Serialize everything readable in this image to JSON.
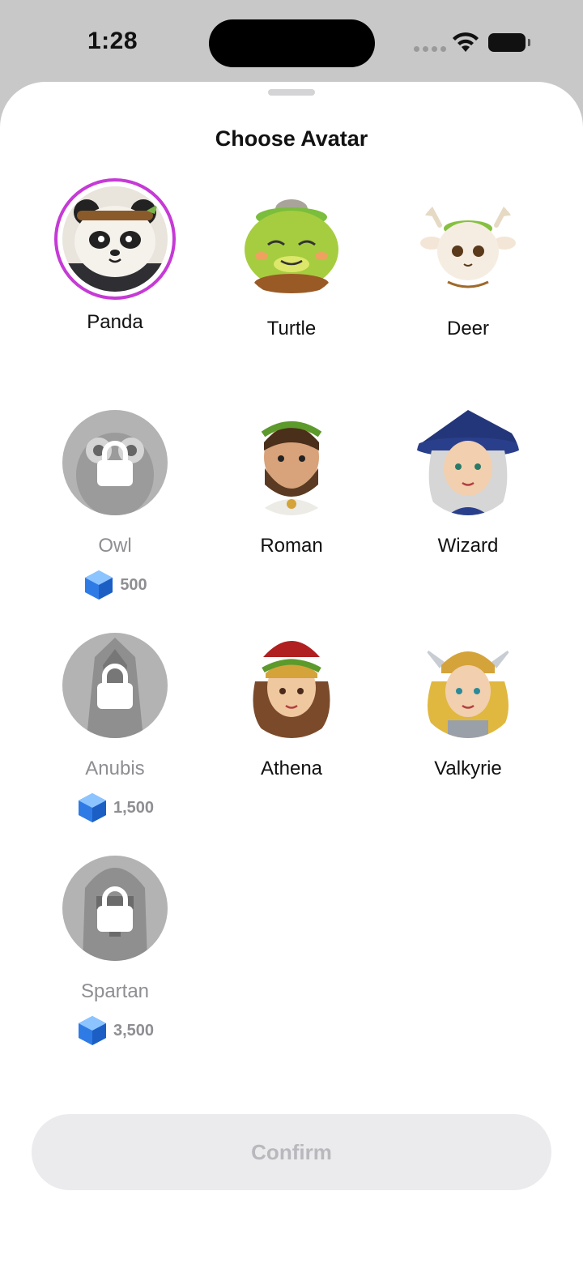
{
  "status_bar": {
    "time": "1:28",
    "wifi_icon": "wifi-icon",
    "battery_icon": "battery-icon"
  },
  "sheet": {
    "title": "Choose Avatar"
  },
  "avatars": [
    {
      "name": "Panda",
      "selected": true,
      "locked": false
    },
    {
      "name": "Turtle",
      "selected": false,
      "locked": false
    },
    {
      "name": "Deer",
      "selected": false,
      "locked": false
    },
    {
      "name": "Owl",
      "selected": false,
      "locked": true,
      "price": "500"
    },
    {
      "name": "Roman",
      "selected": false,
      "locked": false
    },
    {
      "name": "Wizard",
      "selected": false,
      "locked": false
    },
    {
      "name": "Anubis",
      "selected": false,
      "locked": true,
      "price": "1,500"
    },
    {
      "name": "Athena",
      "selected": false,
      "locked": false
    },
    {
      "name": "Valkyrie",
      "selected": false,
      "locked": false
    },
    {
      "name": "Spartan",
      "selected": false,
      "locked": true,
      "price": "3,500"
    }
  ],
  "confirm": {
    "label": "Confirm"
  },
  "colors": {
    "selection_ring": "#c63ad6",
    "gem": "#2f7be6",
    "locked_text": "#8e8e93"
  }
}
